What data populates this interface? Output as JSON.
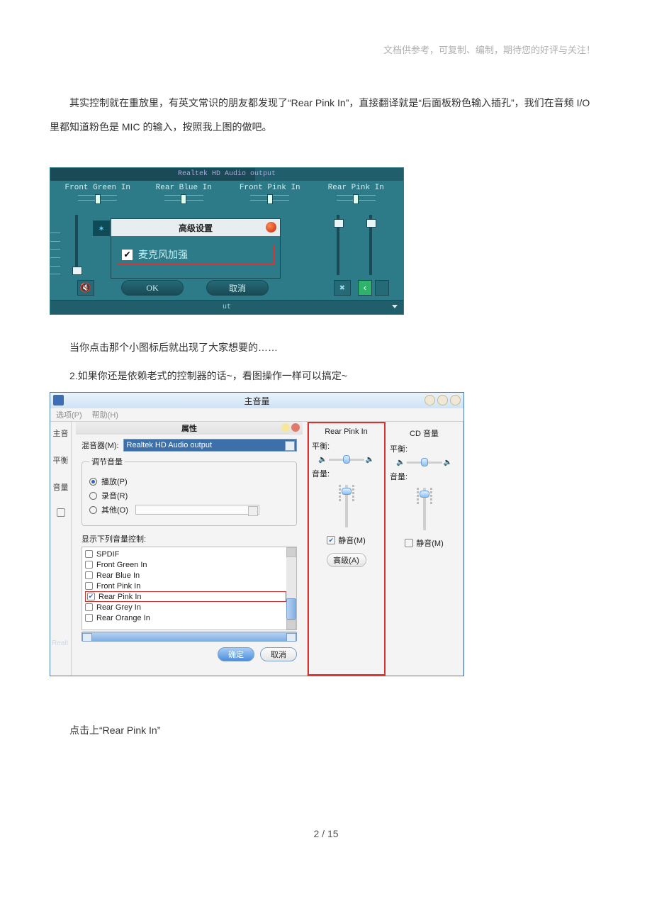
{
  "header_note": "文档供参考，可复制、编制，期待您的好评与关注！",
  "paragraphs": {
    "p1": "其实控制就在重放里，有英文常识的朋友都发现了“Rear Pink In”，直接翻译就是“后面板粉色输入插孔”，我们在音频 I/O 里都知道粉色是 MIC 的输入，按照我上图的做吧。",
    "p2": "当你点击那个小图标后就出现了大家想要的……",
    "p3": "2.如果你还是依赖老式的控制器的话~，看图操作一样可以搞定~",
    "p4": "点击上“Rear Pink In”"
  },
  "shot1": {
    "titlebar": "Realtek HD Audio output",
    "channels": [
      "Front Green In",
      "Rear Blue In",
      "Front Pink In",
      "Rear Pink In"
    ],
    "adv_title": "高级设置",
    "mic_boost": "麦克风加强",
    "ok": "OK",
    "cancel": "取消",
    "foot": "ut"
  },
  "shot2": {
    "window_title": "主音量",
    "menu": {
      "options": "选项(P)",
      "help": "帮助(H)"
    },
    "left_labels": [
      "主音",
      "平衡",
      "音量",
      "Realt"
    ],
    "properties": {
      "title": "属性",
      "mixer_label": "混音器(M):",
      "mixer_value": "Realtek HD Audio output",
      "group_legend": "调节音量",
      "radio_play": "播放(P)",
      "radio_record": "录音(R)",
      "radio_other": "其他(O)",
      "list_label": "显示下列音量控制:",
      "list_items": [
        "SPDIF",
        "Front Green In",
        "Rear Blue In",
        "Front Pink In",
        "Rear Pink In",
        "Rear Grey In",
        "Rear Orange In"
      ],
      "ok": "确定",
      "cancel": "取消"
    },
    "right_channels": {
      "rearpink": {
        "title": "Rear Pink In",
        "balance": "平衡:",
        "volume": "音量:",
        "mute": "静音(M)",
        "advanced": "高级(A)"
      },
      "cd": {
        "title": "CD 音量",
        "balance": "平衡:",
        "volume": "音量:",
        "mute": "静音(M)"
      }
    }
  },
  "footer": "2  / 15"
}
